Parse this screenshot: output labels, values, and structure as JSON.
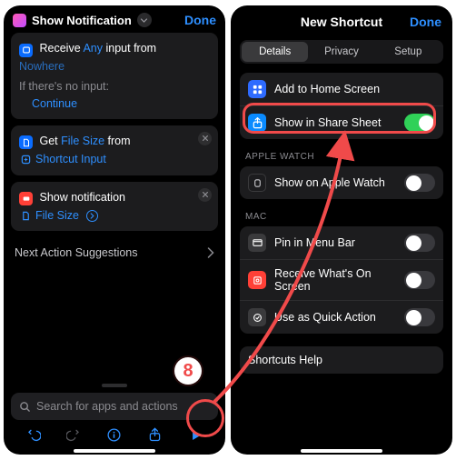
{
  "left": {
    "title": "Show Notification",
    "done": "Done",
    "receive_card": {
      "t1": "Receive",
      "t2": "Any",
      "t3": "input from",
      "nowhere": "Nowhere",
      "no_input": "If there's no input:",
      "continue": "Continue"
    },
    "filesize_card": {
      "t1": "Get",
      "t2": "File Size",
      "t3": "from",
      "sub": "Shortcut Input"
    },
    "notify_card": {
      "t1": "Show notification",
      "sub": "File Size"
    },
    "suggestions": "Next Action Suggestions",
    "search_placeholder": "Search for apps and actions"
  },
  "right": {
    "title": "New Shortcut",
    "done": "Done",
    "tabs": {
      "details": "Details",
      "privacy": "Privacy",
      "setup": "Setup"
    },
    "add_home": "Add to Home Screen",
    "share_sheet": "Show in Share Sheet",
    "sect_watch": "APPLE WATCH",
    "show_watch": "Show on Apple Watch",
    "sect_mac": "MAC",
    "pin_menu": "Pin in Menu Bar",
    "receive_screen": "Receive What's On Screen",
    "quick_action": "Use as Quick Action",
    "help": "Shortcuts Help"
  },
  "annotation": {
    "step": "8"
  },
  "colors": {
    "accent": "#2e8fff",
    "annotation": "#f04a4a",
    "toggle_on": "#30d158"
  }
}
